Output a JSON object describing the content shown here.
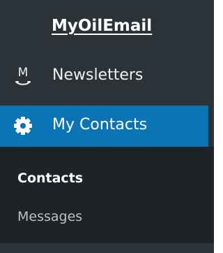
{
  "brand": {
    "title": "MyOilEmail"
  },
  "navigation": {
    "items": [
      {
        "label": "Newsletters",
        "icon": "newsletter-icon",
        "active": false
      },
      {
        "label": "My Contacts",
        "icon": "gear-icon",
        "active": true
      }
    ]
  },
  "submenu": {
    "items": [
      {
        "label": "Contacts",
        "active": true
      },
      {
        "label": "Messages",
        "active": false
      }
    ]
  },
  "colors": {
    "sidebar_background": "#2c3338",
    "active_background": "#0b74b5",
    "submenu_background": "#1d2327",
    "primary_text": "#ffffff",
    "secondary_text": "#b8c0c8"
  }
}
